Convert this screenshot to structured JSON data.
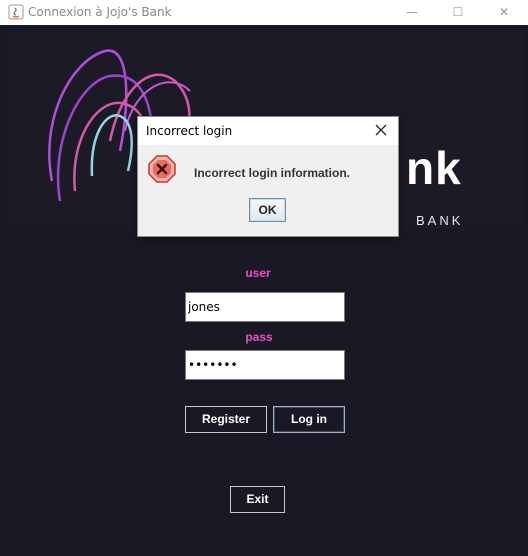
{
  "window": {
    "title": "Connexion à Jojo's Bank",
    "controls": {
      "minimize": "—",
      "maximize": "☐",
      "close": "✕"
    }
  },
  "banner": {
    "brand_partial": "nk",
    "sub_partial": "BANK",
    "logo_colors": [
      "#b04fd8",
      "#d35aa8",
      "#8fd6e6"
    ]
  },
  "form": {
    "user_label": "user",
    "user_value": "jones",
    "pass_label": "pass",
    "pass_value": "•••••••",
    "register_label": "Register",
    "login_label": "Log in",
    "exit_label": "Exit"
  },
  "dialog": {
    "title": "Incorrect login",
    "message": "Incorrect login information.",
    "ok_label": "OK",
    "icon": "error-icon",
    "close_icon": "close-icon"
  },
  "colors": {
    "background": "#1a1825",
    "label_accent": "#e94fc4",
    "error_red": "#d9413a"
  }
}
